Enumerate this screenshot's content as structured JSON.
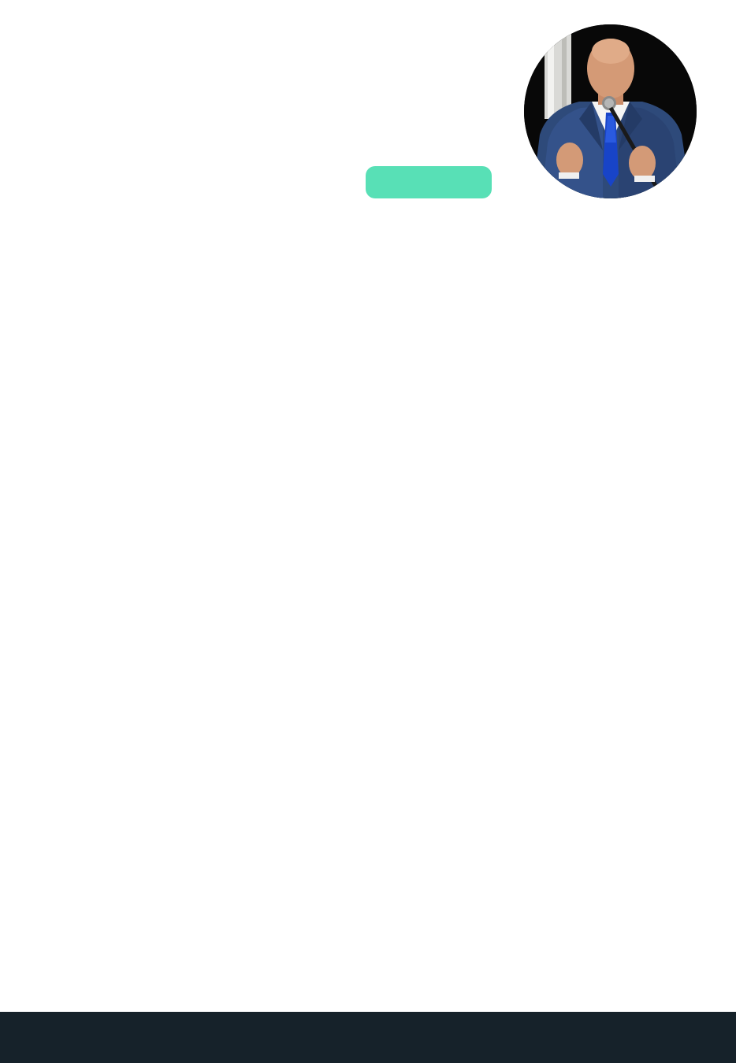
{
  "cta": {
    "label": "",
    "color": "#58E0B6"
  },
  "avatar": {
    "icon": "speaker-portrait-photo",
    "alt": ""
  },
  "footer": {
    "background": "#16222A"
  }
}
